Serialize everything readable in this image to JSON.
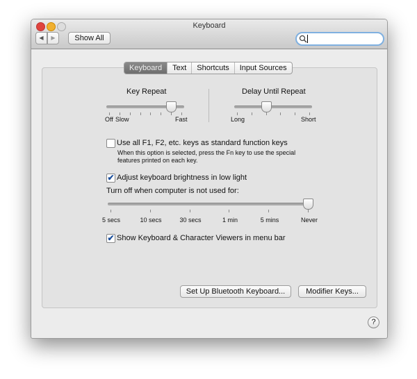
{
  "window": {
    "title": "Keyboard",
    "show_all": "Show All",
    "search_value": "",
    "back_icon": "◀",
    "forward_icon": "▶",
    "help": "?"
  },
  "tabs": [
    {
      "label": "Keyboard",
      "selected": true
    },
    {
      "label": "Text"
    },
    {
      "label": "Shortcuts"
    },
    {
      "label": "Input Sources"
    }
  ],
  "key_repeat": {
    "title": "Key Repeat",
    "labels": [
      "Off",
      "Slow",
      "Fast"
    ],
    "ticks": 8,
    "value_index": 6
  },
  "delay": {
    "title": "Delay Until Repeat",
    "labels": [
      "Long",
      "Short"
    ],
    "ticks": 6,
    "value_index": 2
  },
  "fn_keys": {
    "label": "Use all F1, F2, etc. keys as standard function keys",
    "checked": false,
    "note1": "When this option is selected, press the Fn key to use the special",
    "note2": "features printed on each key."
  },
  "brightness": {
    "label": "Adjust keyboard brightness in low light",
    "checked": true,
    "turn_off_label": "Turn off when computer is not used for:",
    "options": [
      "5 secs",
      "10 secs",
      "30 secs",
      "1 min",
      "5 mins",
      "Never"
    ],
    "value_index": 5
  },
  "viewers": {
    "label": "Show Keyboard & Character Viewers in menu bar",
    "checked": true
  },
  "buttons": {
    "bluetooth": "Set Up Bluetooth Keyboard...",
    "modifier": "Modifier Keys..."
  }
}
